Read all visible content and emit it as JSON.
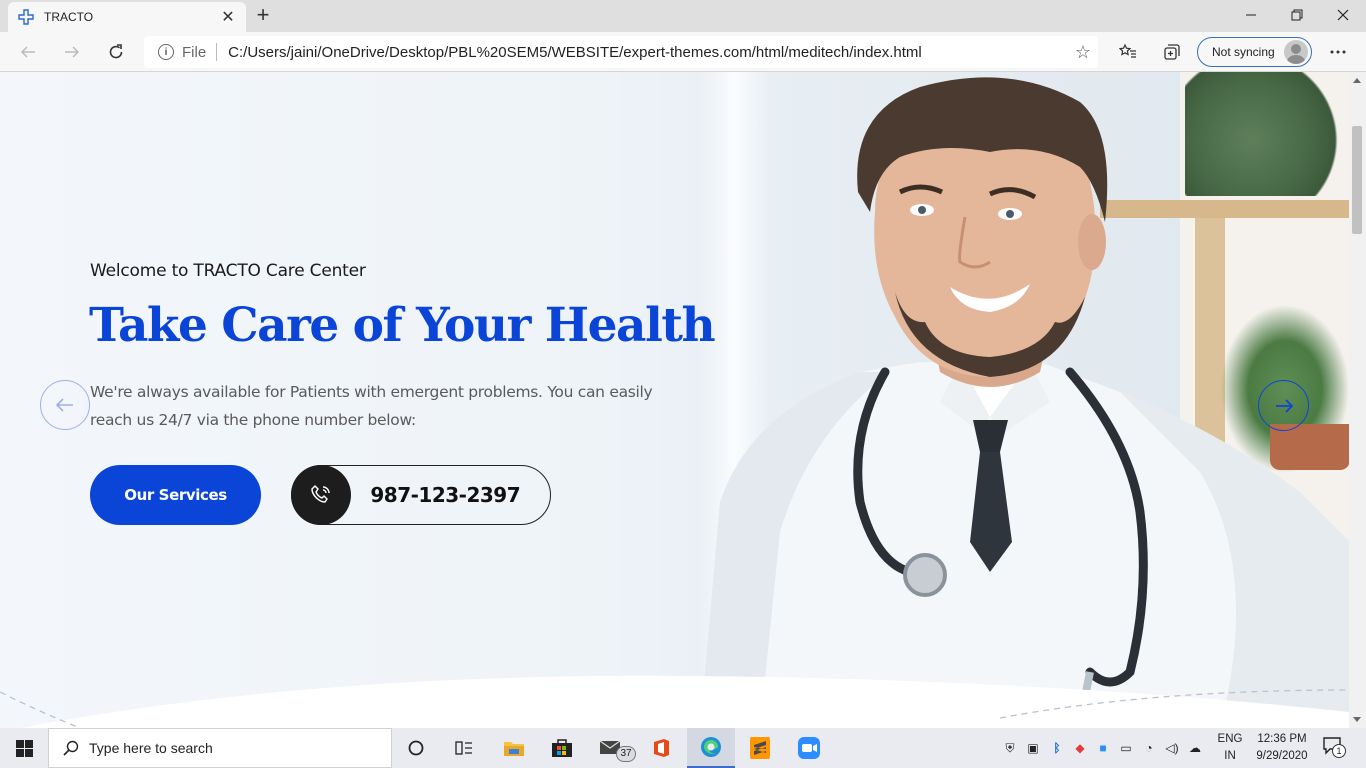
{
  "browser": {
    "tab_title": "TRACTO",
    "address_prefix": "File",
    "url": "C:/Users/jaini/OneDrive/Desktop/PBL%20SEM5/WEBSITE/expert-themes.com/html/meditech/index.html",
    "sync_label": "Not syncing"
  },
  "hero": {
    "welcome": "Welcome to TRACTO Care Center",
    "headline": "Take Care of Your Health",
    "description": "We're always available for Patients with emergent problems. You can easily reach us 24/7 via the phone number below:",
    "services_button": "Our Services",
    "phone": "987-123-2397"
  },
  "taskbar": {
    "search_placeholder": "Type here to search",
    "mail_badge": "37",
    "lang_line1": "ENG",
    "lang_line2": "IN",
    "time": "12:36 PM",
    "date": "9/29/2020",
    "notification_count": "1"
  },
  "colors": {
    "accent": "#0a45d8",
    "dark": "#1d1d1d"
  }
}
